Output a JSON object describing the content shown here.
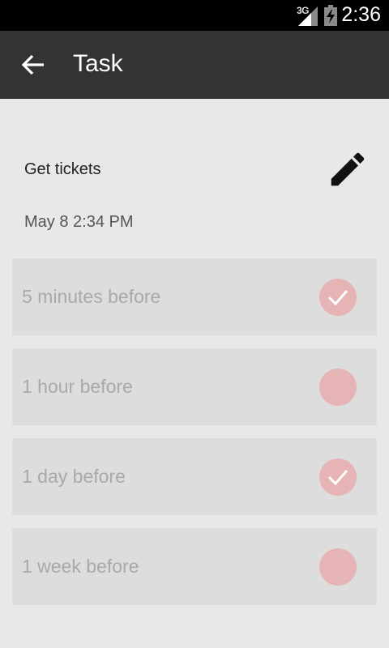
{
  "status_bar": {
    "network_label": "3G",
    "time": "2:36"
  },
  "app_bar": {
    "back_icon": "arrow-left-icon",
    "title": "Task"
  },
  "task": {
    "name": "Get tickets",
    "datetime": "May 8 2:34 PM",
    "edit_icon": "pencil-icon"
  },
  "reminders": [
    {
      "label": "5 minutes before",
      "checked": true
    },
    {
      "label": "1 hour before",
      "checked": false
    },
    {
      "label": "1 day before",
      "checked": true
    },
    {
      "label": "1 week before",
      "checked": false
    }
  ],
  "colors": {
    "app_bar": "#333333",
    "background": "#e8e8e8",
    "reminder_row": "#dddddd",
    "toggle": "#e6b4b4"
  }
}
